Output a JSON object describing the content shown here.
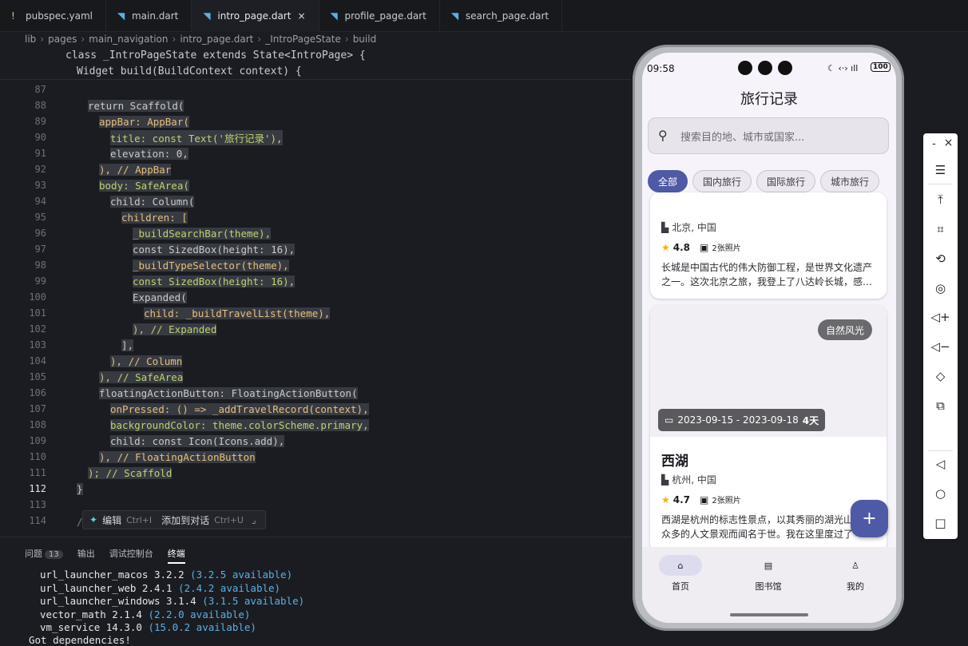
{
  "tabs": [
    {
      "label": "pubspec.yaml",
      "icon": "!",
      "icon_color": "#e5c07b"
    },
    {
      "label": "main.dart",
      "icon": "◥",
      "icon_color": "#59b0e8"
    },
    {
      "label": "intro_page.dart",
      "icon": "◥",
      "icon_color": "#59b0e8",
      "active": true,
      "close": "×"
    },
    {
      "label": "profile_page.dart",
      "icon": "◥",
      "icon_color": "#59b0e8"
    },
    {
      "label": "search_page.dart",
      "icon": "◥",
      "icon_color": "#59b0e8"
    }
  ],
  "breadcrumb": [
    "lib",
    "pages",
    "main_navigation",
    "intro_page.dart",
    "_IntroPageState",
    "build"
  ],
  "sticky": {
    "line1": "class _IntroPageState extends State<IntroPage> {",
    "line2": "Widget build(BuildContext context) {"
  },
  "code": [
    {
      "n": "87",
      "t": ""
    },
    {
      "n": "88",
      "t": "return Scaffold("
    },
    {
      "n": "89",
      "t": "appBar: AppBar("
    },
    {
      "n": "90",
      "t": "title: const Text('旅行记录'),"
    },
    {
      "n": "91",
      "t": "elevation: 0,"
    },
    {
      "n": "92",
      "t": "), // AppBar"
    },
    {
      "n": "93",
      "t": "body: SafeArea("
    },
    {
      "n": "94",
      "t": "child: Column("
    },
    {
      "n": "95",
      "t": "children: ["
    },
    {
      "n": "96",
      "t": "_buildSearchBar(theme),"
    },
    {
      "n": "97",
      "t": "const SizedBox(height: 16),"
    },
    {
      "n": "98",
      "t": "_buildTypeSelector(theme),"
    },
    {
      "n": "99",
      "t": "const SizedBox(height: 16),"
    },
    {
      "n": "100",
      "t": "Expanded("
    },
    {
      "n": "101",
      "t": "child: _buildTravelList(theme),"
    },
    {
      "n": "102",
      "t": "), // Expanded"
    },
    {
      "n": "103",
      "t": "],"
    },
    {
      "n": "104",
      "t": "), // Column"
    },
    {
      "n": "105",
      "t": "), // SafeArea"
    },
    {
      "n": "106",
      "t": "floatingActionButton: FloatingActionButton("
    },
    {
      "n": "107",
      "t": "onPressed: () => _addTravelRecord(context),"
    },
    {
      "n": "108",
      "t": "backgroundColor: theme.colorScheme.primary,"
    },
    {
      "n": "109",
      "t": "child: const Icon(Icons.add),"
    },
    {
      "n": "110",
      "t": "), // FloatingActionButton"
    },
    {
      "n": "111",
      "t": "); // Scaffold"
    },
    {
      "n": "112",
      "t": "}"
    },
    {
      "n": "113",
      "t": ""
    },
    {
      "n": "114",
      "t": "/// 构建搜索栏"
    }
  ],
  "inline_menu": {
    "edit": "编辑",
    "edit_key": "Ctrl+I",
    "add": "添加到对话",
    "add_key": "Ctrl+U"
  },
  "panel": {
    "tabs": {
      "problems": "问题",
      "problems_count": "13",
      "output": "输出",
      "debug": "调试控制台",
      "terminal": "终端"
    },
    "lines": [
      {
        "pkg": "url_launcher_macos 3.2.2",
        "avail": "(3.2.5 available)"
      },
      {
        "pkg": "url_launcher_web 2.4.1",
        "avail": "(2.4.2 available)"
      },
      {
        "pkg": "url_launcher_windows 3.1.4",
        "avail": "(3.1.5 available)"
      },
      {
        "pkg": "vector_math 2.1.4",
        "avail": "(2.2.0 available)"
      },
      {
        "pkg": "vm_service 14.3.0",
        "avail": "(15.0.2 available)"
      }
    ],
    "last": "Got dependencies!"
  },
  "phone": {
    "time": "09:58",
    "status_icons": "☾ ‹·› ıll",
    "battery": "100",
    "title": "旅行记录",
    "search_placeholder": "搜索目的地、城市或国家...",
    "chips": [
      "全部",
      "国内旅行",
      "国际旅行",
      "城市旅行"
    ],
    "card1": {
      "location": "北京, 中国",
      "rating": "4.8",
      "photos": "2张照片",
      "desc1": "长城是中国古代的伟大防御工程，是世界文化遗产",
      "desc2": "之一。这次北京之旅，我登上了八达岭长城，感…"
    },
    "card2": {
      "tag": "自然风光",
      "dates": "2023-09-15 - 2023-09-18",
      "days": "4天",
      "name": "西湖",
      "location": "杭州, 中国",
      "rating": "4.7",
      "photos": "2张照片",
      "desc1": "西湖是杭州的标志性景点，以其秀丽的湖光山色",
      "desc2": "众多的人文景观而闻名于世。我在这里度过了"
    },
    "fab": "+",
    "nav": [
      "首页",
      "图书馆",
      "我的"
    ]
  },
  "emulator": {
    "minimize": "-",
    "close": "×"
  }
}
